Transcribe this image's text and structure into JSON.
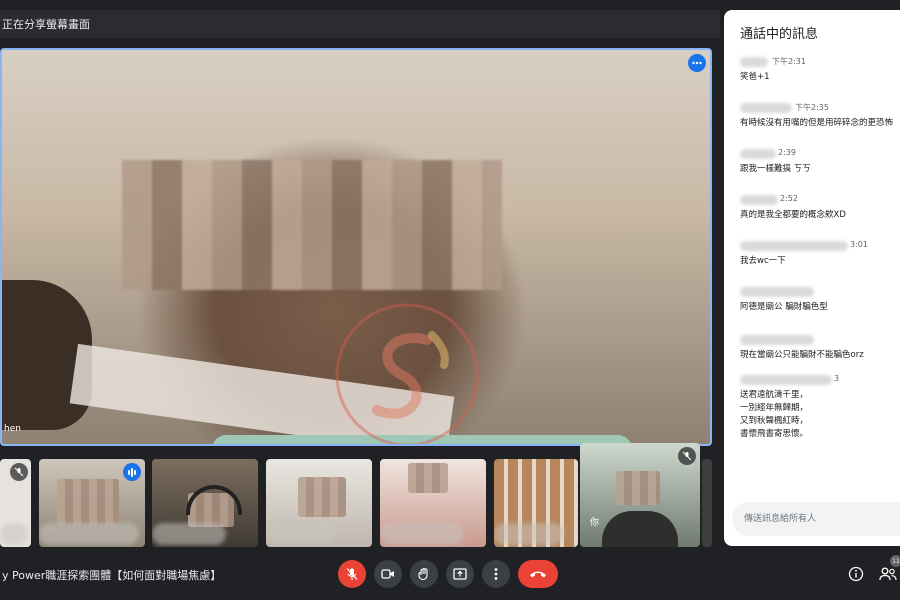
{
  "banner": {
    "text": "正在分享螢幕畫面"
  },
  "main_video": {
    "participant_name": "hen"
  },
  "thumbnails": [
    {
      "id": "t1",
      "label": ""
    },
    {
      "id": "t2",
      "label": ""
    },
    {
      "id": "t3",
      "label": ""
    },
    {
      "id": "t4",
      "label": ""
    },
    {
      "id": "t5",
      "label": ""
    },
    {
      "id": "t6",
      "label": "你"
    },
    {
      "id": "t7",
      "label": ""
    }
  ],
  "chat": {
    "title": "通話中的訊息",
    "messages": [
      {
        "time": "下午2:31",
        "text": "笑爸+1"
      },
      {
        "time": "下午2:35",
        "text": "有時候沒有用嘴的但是用碎碎念的更恐怖"
      },
      {
        "time": "2:39",
        "text": "跟我一樣難搞 ㄎㄎ"
      },
      {
        "time": "2:52",
        "text": "真的是我全都要的概念欸XD"
      },
      {
        "time": "3:01",
        "text": "我去wc一下"
      },
      {
        "time": "",
        "text": "阿德是廟公 騙財騙色型"
      },
      {
        "time": "",
        "text": "現在當廟公只能騙財不能騙色orz"
      },
      {
        "time": "3",
        "text": "送君遠航濤千里，\n一別經年無歸期，\n又到秋聲楓紅時，\n書懷飛書寄思懷。"
      }
    ],
    "input_placeholder": "傳送訊息給所有人"
  },
  "meeting": {
    "title": "y Power職涯探索團體【如何面對職場焦慮】"
  },
  "participants_count": "11",
  "colors": {
    "end_call": "#ea4335",
    "accent": "#1a73e8",
    "active_border": "#8ab4f8"
  },
  "icons": [
    "more-icon",
    "mic-off-icon",
    "camera-icon",
    "raise-hand-icon",
    "present-screen-icon",
    "more-vert-icon",
    "end-call-icon",
    "info-icon",
    "people-icon"
  ]
}
